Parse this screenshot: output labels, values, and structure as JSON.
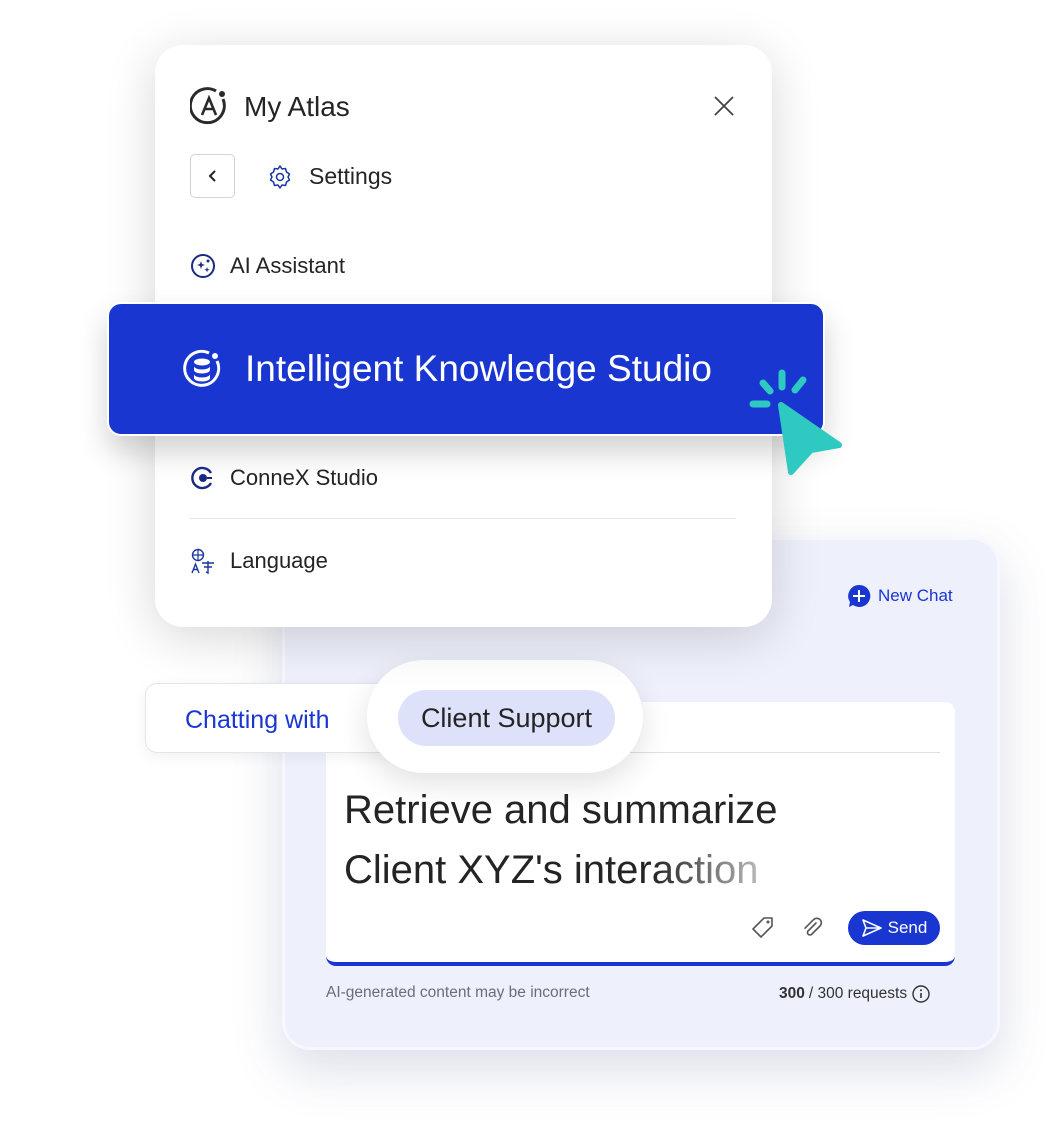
{
  "menu": {
    "title": "My Atlas",
    "settings_label": "Settings",
    "items": [
      {
        "label": "AI Assistant",
        "icon": "sparkle-circle-icon"
      },
      {
        "label": "Intelligent Knowledge Studio",
        "icon": "database-icon",
        "selected": true
      },
      {
        "label": "ConneX Studio",
        "icon": "connex-icon"
      },
      {
        "label": "Language",
        "icon": "translate-icon"
      }
    ]
  },
  "chat": {
    "new_chat_label": "New Chat",
    "chatting_with_label": "Chatting with",
    "agent_name": "Client Support",
    "prompt_line1": "Retrieve and summarize",
    "prompt_line2_solid": "Client XYZ's inter",
    "prompt_line2_fade": "action",
    "send_label": "Send",
    "disclaimer": "AI-generated content may be incorrect",
    "requests_used": "300",
    "requests_total": "/ 300 requests"
  },
  "colors": {
    "accent": "#1a36d1",
    "cursor": "#2ec9c0",
    "panel": "#eef0fc"
  }
}
